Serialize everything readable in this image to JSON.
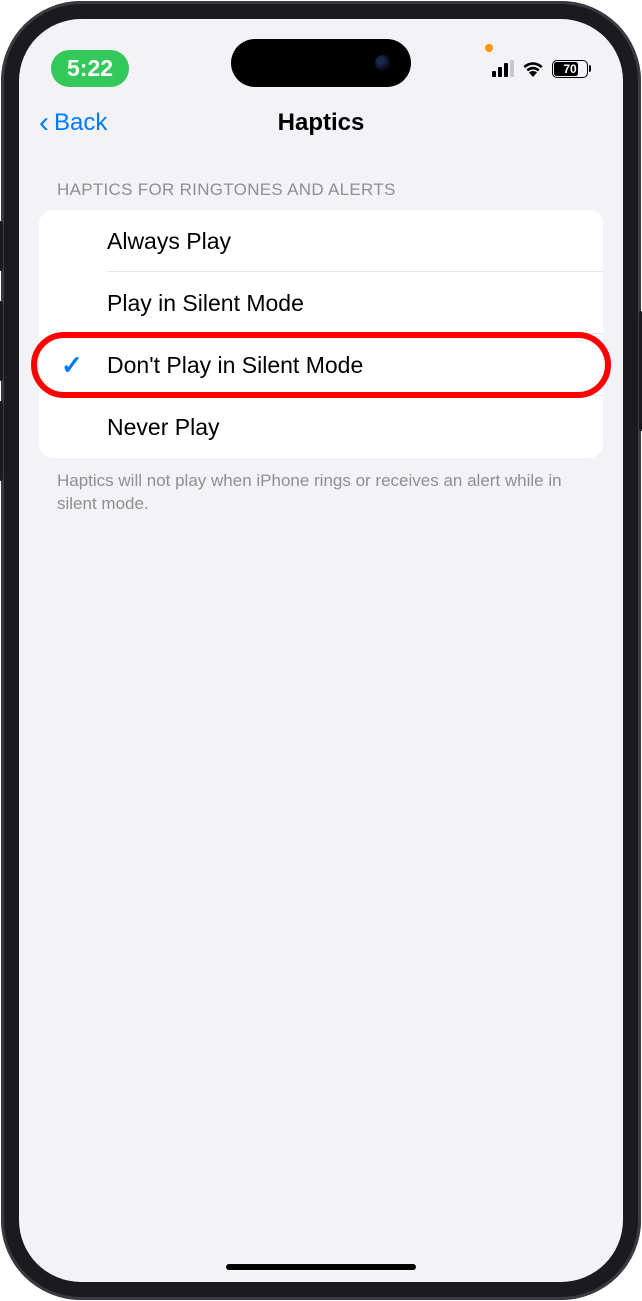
{
  "status_bar": {
    "time": "5:22",
    "battery_percent": "70"
  },
  "nav": {
    "back_label": "Back",
    "title": "Haptics"
  },
  "section": {
    "header": "HAPTICS FOR RINGTONES AND ALERTS",
    "footer": "Haptics will not play when iPhone rings or receives an alert while in silent mode."
  },
  "options": [
    {
      "label": "Always Play",
      "selected": false,
      "highlighted": false
    },
    {
      "label": "Play in Silent Mode",
      "selected": false,
      "highlighted": false
    },
    {
      "label": "Don't Play in Silent Mode",
      "selected": true,
      "highlighted": true
    },
    {
      "label": "Never Play",
      "selected": false,
      "highlighted": false
    }
  ]
}
